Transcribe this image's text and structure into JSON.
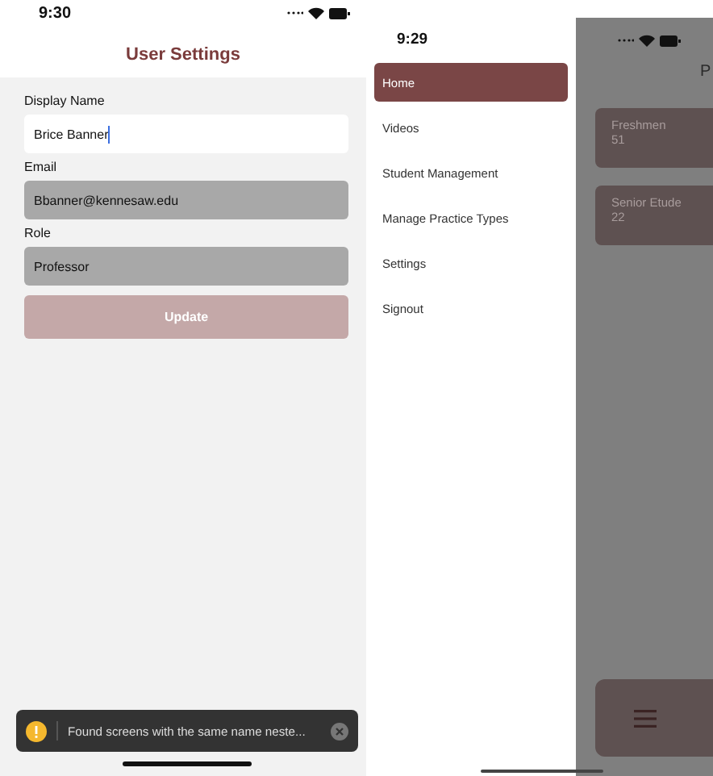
{
  "settings_screen": {
    "status_bar": {
      "time": "9:30"
    },
    "title": "User Settings",
    "fields": [
      {
        "label": "Display Name",
        "value": "Brice Banner",
        "disabled": false,
        "focused": true
      },
      {
        "label": "Email",
        "value": "Bbanner@kennesaw.edu",
        "disabled": true,
        "focused": false
      },
      {
        "label": "Role",
        "value": "Professor",
        "disabled": true,
        "focused": false
      }
    ],
    "button": {
      "label": "Update",
      "disabled": true
    },
    "toast": {
      "message": "Found screens with the same name neste..."
    }
  },
  "drawer": {
    "status_bar": {
      "time": "9:29"
    },
    "items": [
      {
        "label": "Home",
        "selected": true
      },
      {
        "label": "Videos",
        "selected": false
      },
      {
        "label": "Student Management",
        "selected": false
      },
      {
        "label": "Manage Practice Types",
        "selected": false
      },
      {
        "label": "Settings",
        "selected": false
      },
      {
        "label": "Signout",
        "selected": false
      }
    ]
  },
  "dimmed_screen": {
    "title": "P",
    "cards": [
      {
        "title": "Freshmen",
        "count": "51"
      },
      {
        "title": "Senior Etude",
        "count": "22"
      }
    ]
  }
}
